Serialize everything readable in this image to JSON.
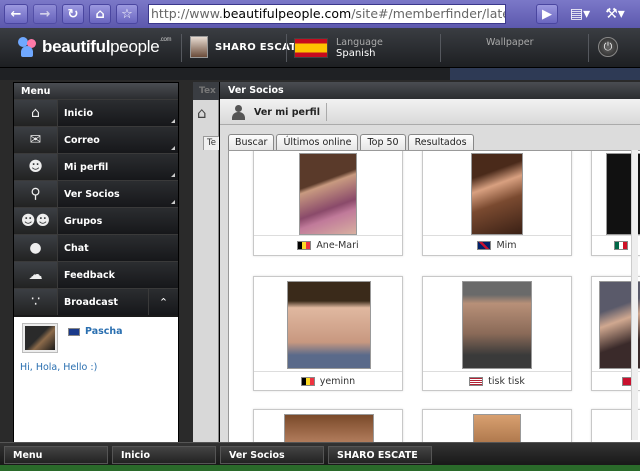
{
  "browser": {
    "url_prefix": "http://www.",
    "url_domain": "beautifulpeople.com",
    "url_path": "/site#/memberfinder/latestonline",
    "back_icon": "arrow-left-icon",
    "forward_icon": "arrow-right-icon",
    "reload_icon": "reload-icon",
    "home_icon": "home-icon",
    "bookmark_icon": "star-icon"
  },
  "header": {
    "logo_bold": "beautiful",
    "logo_rest": "people",
    "logo_com": ".com",
    "username": "SHARO ESCATE",
    "language_title": "Language",
    "language_value": "Spanish",
    "wallpaper": "Wallpaper"
  },
  "menu": {
    "title": "Menu",
    "items": [
      {
        "label": "Inicio",
        "icon": "home-icon"
      },
      {
        "label": "Correo",
        "icon": "mail-icon"
      },
      {
        "label": "Mi perfil",
        "icon": "person-icon"
      },
      {
        "label": "Ver Socios",
        "icon": "search-person-icon"
      },
      {
        "label": "Grupos",
        "icon": "group-icon"
      },
      {
        "label": "Chat",
        "icon": "chat-bubble-icon"
      },
      {
        "label": "Feedback",
        "icon": "feedback-icon"
      },
      {
        "label": "Broadcast",
        "icon": "rss-icon"
      }
    ],
    "chat": {
      "name": "Pascha",
      "message": "Hi, Hola, Hello :)"
    }
  },
  "main": {
    "side_tab": "Tex",
    "side_tab_small": "Te",
    "window_title": "Ver Socios",
    "toolbar_label": "Ver mi perfil",
    "tabs": [
      "Buscar",
      "Últimos online",
      "Top 50",
      "Resultados"
    ],
    "members": [
      {
        "name": "Ane-Mari",
        "flag": "belgium"
      },
      {
        "name": "Mim",
        "flag": "uk"
      },
      {
        "name": "",
        "flag": "mexico"
      },
      {
        "name": "yeminn",
        "flag": "belgium"
      },
      {
        "name": "tisk tisk",
        "flag": "usa"
      },
      {
        "name": "",
        "flag": "unknown"
      }
    ]
  },
  "taskbar": {
    "items": [
      "Menu",
      "Inicio",
      "Ver Socios",
      "SHARO ESCATE"
    ]
  },
  "colors": {
    "browser_accent": "#6a66c0",
    "link_blue": "#2a6fb0",
    "dark_panel": "#1a1a1a"
  }
}
